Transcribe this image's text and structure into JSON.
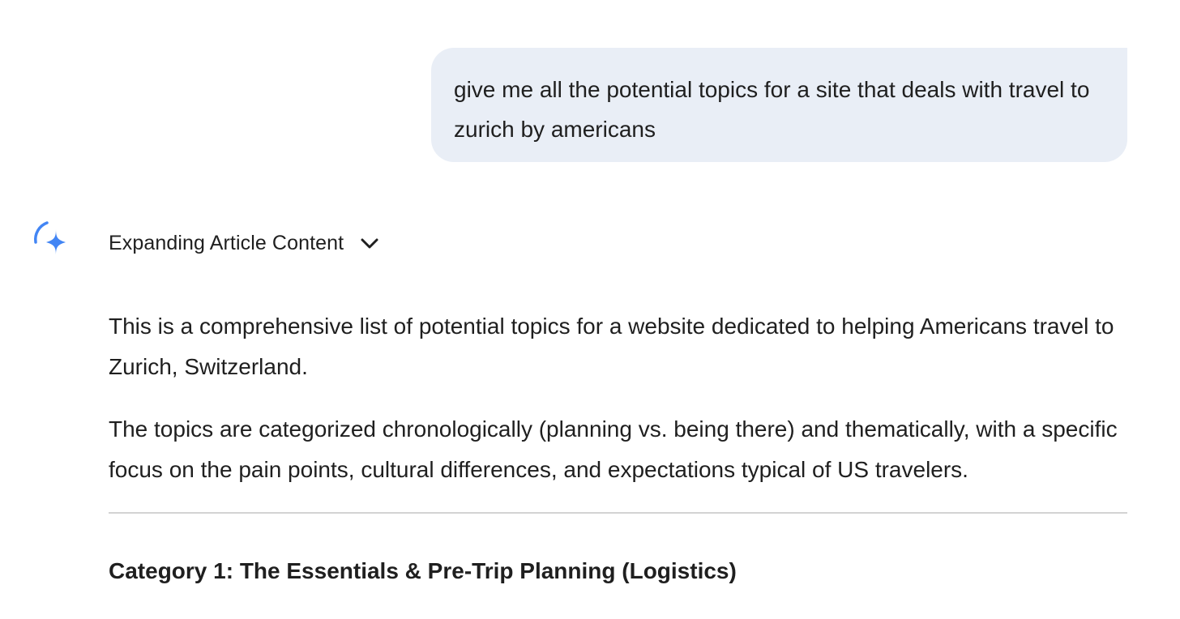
{
  "user_message": {
    "text": "give me all the potential topics for a site that deals with travel to zurich by americans"
  },
  "assistant": {
    "icon": "gemini-sparkle-icon",
    "thinking": {
      "label": "Expanding Article Content",
      "toggle_icon": "chevron-down-icon"
    },
    "paragraphs": [
      "This is a comprehensive list of potential topics for a website dedicated to helping Americans travel to Zurich, Switzerland.",
      "The topics are categorized chronologically (planning vs. being there) and thematically, with a specific focus on the pain points, cultural differences, and expectations typical of US travelers."
    ],
    "category_heading": "Category 1: The Essentials & Pre-Trip Planning (Logistics)"
  },
  "colors": {
    "user_bubble_bg": "#e9eef6",
    "text": "#1f1f1f",
    "divider": "#d3d3d3",
    "accent_blue": "#4285f4"
  }
}
